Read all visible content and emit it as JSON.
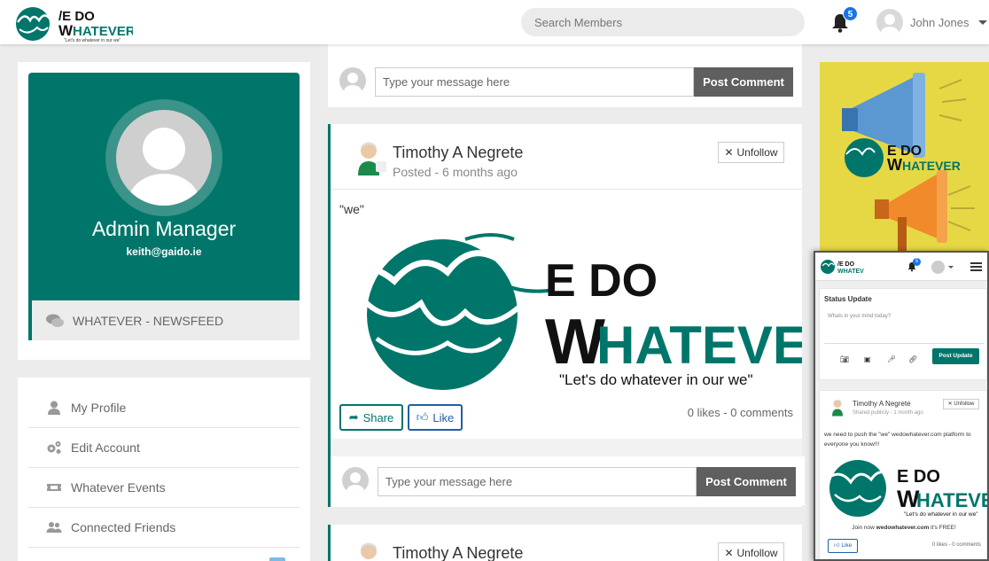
{
  "header": {
    "logo_alt": "We Do Whatever",
    "search_placeholder": "Search Members",
    "notification_count": "5",
    "user_name": "John Jones"
  },
  "profile": {
    "name": "Admin Manager",
    "email": "keith@gaido.ie",
    "newsfeed_label": "WHATEVER - NEWSFEED"
  },
  "menu": {
    "items": [
      {
        "label": "My Profile",
        "icon": "user-icon"
      },
      {
        "label": "Edit Account",
        "icon": "gears-icon"
      },
      {
        "label": "Whatever Events",
        "icon": "ticket-icon"
      },
      {
        "label": "Connected Friends",
        "icon": "users-icon"
      }
    ]
  },
  "comment_box": {
    "placeholder": "Type your message here",
    "button_label": "Post Comment"
  },
  "post": {
    "author": "Timothy A Negrete",
    "meta": "Posted - 6 months ago",
    "unfollow_label": "Unfollow",
    "text": "\"we\"",
    "share_label": "Share",
    "like_label": "Like",
    "stats": "0 likes - 0 comments"
  },
  "post2": {
    "author": "Timothy A Negrete",
    "unfollow_label": "Unfollow"
  },
  "logo_text": {
    "line1": "E DO",
    "line2": "HATEVER",
    "tagline": "\"Let's do whatever in our we\""
  },
  "mini": {
    "notification_count": "5",
    "status_title": "Status Update",
    "status_placeholder": "Whats in your mind today?",
    "post_update_label": "Post Update",
    "author": "Timothy A Negrete",
    "meta": "Shared publicly - 1 month ago",
    "unfollow_label": "Unfollow",
    "text": "we need to push the \"we\" wedowhatever.com platform to everyone you know!!!",
    "join_prefix": "Join now ",
    "join_site": "wedowhatever.com",
    "join_suffix": " it's FREE!",
    "like_label": "Like",
    "stats": "0 likes - 0 comments"
  },
  "colors": {
    "brand_green": "#00766a",
    "accent_blue": "#1a73e8",
    "promo_yellow": "#e6d844"
  }
}
